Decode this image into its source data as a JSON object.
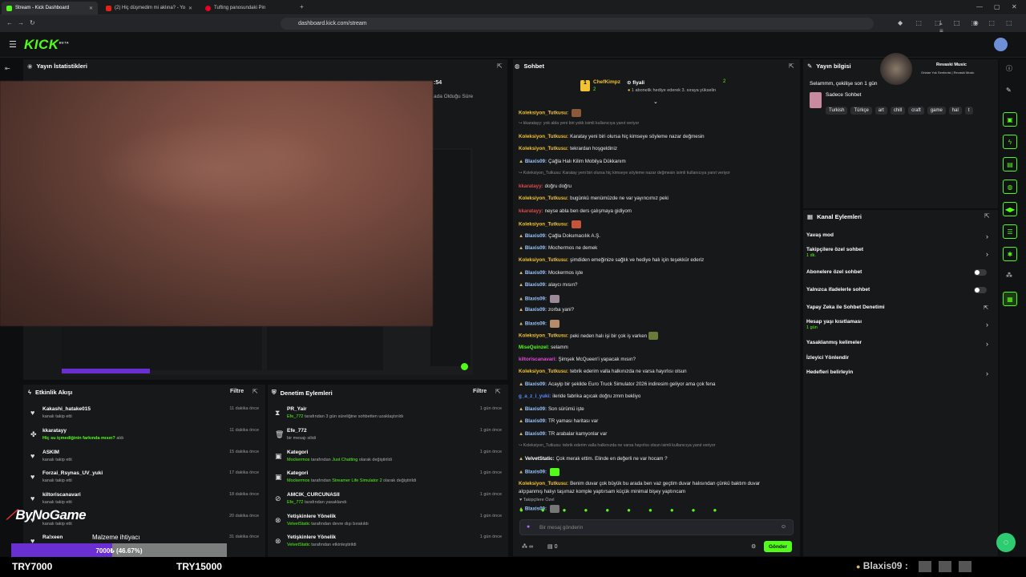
{
  "browser": {
    "tabs": [
      {
        "label": "Stream - Kick Dashboard"
      },
      {
        "label": "(2) Hiç düşmedim mi aklına? - Yo"
      },
      {
        "label": "Tufting panosundaki Pin"
      }
    ],
    "url": "dashboard.kick.com/stream"
  },
  "kick": {
    "logo": "KICK",
    "beta": "BETA"
  },
  "stats": {
    "title": "Yayın İstatistikleri",
    "clock": ":54",
    "subtitle": "ada Olduğu Süre"
  },
  "activity": {
    "title": "Etkinlik Akışı",
    "filter": "Filtre",
    "items": [
      {
        "name": "Kakashi_hatake015",
        "detail": "kanalı takip etti",
        "time": "11 dakika önce"
      },
      {
        "name": "kkaratayy",
        "detail": "Hiç su içmediğinin farkında mısın?",
        "detail2": "aldı",
        "time": "11 dakika önce"
      },
      {
        "name": "ASKIM",
        "detail": "kanalı takip etti",
        "time": "15 dakika önce"
      },
      {
        "name": "Forzai_Rsynas_UV_yuki",
        "detail": "kanalı takip etti",
        "time": "17 dakika önce"
      },
      {
        "name": "kiltoriscanavari",
        "detail": "kanalı takip etti",
        "time": "18 dakika önce"
      },
      {
        "name": "",
        "detail": "kanalı takip etti",
        "time": "20 dakika önce"
      },
      {
        "name": "Ra!xeen",
        "detail": "",
        "time": "31 dakika önce"
      }
    ]
  },
  "modlog": {
    "title": "Denetim Eylemleri",
    "filter": "Filtre",
    "items": [
      {
        "name": "PR_Yair",
        "actor": "Efe_772",
        "detail": "tarafından 3 gün süreliğine sohbetten uzaklaştırıldı",
        "time": "1 gün önce"
      },
      {
        "name": "Efe_772",
        "actor": "",
        "detail": "bir mesajı silidi",
        "time": "1 gün önce"
      },
      {
        "name": "Kategori",
        "actor": "Mockermos",
        "detail": "tarafından",
        "detail_green": "Just Chatting",
        "detail_tail": "olarak değiştirildi",
        "time": "1 gün önce"
      },
      {
        "name": "Kategori",
        "actor": "Mockermos",
        "detail": "tarafından",
        "detail_green": "Streamer Life Simulator 2",
        "detail_tail": "olarak değiştirildi",
        "time": "1 gün önce"
      },
      {
        "name": "AMCIK_CURCUNASII",
        "actor": "Efe_772",
        "detail": "tarafından yasaklandı",
        "time": "1 gün önce"
      },
      {
        "name": "Yetişkinlere Yönelik",
        "actor": "VelvetStatic",
        "detail": "tarafından devre dışı bırakıldı",
        "time": "1 gün önce"
      },
      {
        "name": "Yetişkinlere Yönelik",
        "actor": "VelvetStatic",
        "detail": "tarafından etkinleştirildi",
        "time": "1 gün önce"
      }
    ]
  },
  "overlay": {
    "brand": "ByNoGame",
    "goal_title": "Malzeme ihtiyacı",
    "goal_value": "7000₺ (46.67%)",
    "goal_progress": 0.4667,
    "goal_min": "TRY7000",
    "goal_max": "TRY15000",
    "bottom_user": "Blaxis09 :"
  },
  "chat": {
    "title": "Sohbet",
    "leader": {
      "name": "ChefKimpz",
      "count_left": "2",
      "user": "fiyali",
      "count_right": "2",
      "note": "1 abonelik hediye ederek 3. sıraya yükselin"
    },
    "messages": [
      {
        "user": "Koleksiyon_Tutkusu:",
        "text": "",
        "color": "#f1c232",
        "emote": "#8a5a3a"
      },
      {
        "reply": "↪ kkaratayy: yok abla yeni biri yokk isimli kullanıcıya yanıt veriyor"
      },
      {
        "user": "Koleksiyon_Tutkusu:",
        "text": "Karatay yeni biri olursa hiç kimseye söyleme nazar değmesin",
        "color": "#f1c232"
      },
      {
        "user": "Koleksiyon_Tutkusu:",
        "text": "tekrardan hoşgeldiniz",
        "color": "#f1c232"
      },
      {
        "user": "Blaxis09:",
        "text": "Çağla Halı Kilim Mobilya Dükkanım",
        "color": "#9cc5ff",
        "badge": true
      },
      {
        "reply": "↪ Koleksiyon_Tutkusu: Karatay yeni biri olursa hiç kimseye söyleme nazar değmesin isimli kullanıcıya yanıt veriyor"
      },
      {
        "user": "kkaratayy:",
        "text": "doğru doğru",
        "color": "#d94a4a"
      },
      {
        "user": "Koleksiyon_Tutkusu:",
        "text": "bugünkü menümüzde ne var yayıncımız peki",
        "color": "#f1c232"
      },
      {
        "user": "kkaratayy:",
        "text": "neyse abla ben ders çalışmaya gidiyom",
        "color": "#d94a4a"
      },
      {
        "user": "Koleksiyon_Tutkusu:",
        "text": "",
        "color": "#f1c232",
        "emote": "#c4553a"
      },
      {
        "user": "Blaxis09:",
        "text": "Çağla Dokumacılık A.Ş.",
        "color": "#9cc5ff",
        "badge": true
      },
      {
        "user": "Blaxis09:",
        "text": "Mochermos ne demek",
        "color": "#9cc5ff",
        "badge": true
      },
      {
        "user": "Koleksiyon_Tutkusu:",
        "text": "şimdiden emeğinize sağlık ve hediye halı için teşekkür ederiz",
        "color": "#f1c232"
      },
      {
        "user": "Blaxis09:",
        "text": "Mockermos işte",
        "color": "#9cc5ff",
        "badge": true
      },
      {
        "user": "Blaxis09:",
        "text": "alaycı mısın?",
        "color": "#9cc5ff",
        "badge": true
      },
      {
        "user": "Blaxis09:",
        "text": "",
        "color": "#9cc5ff",
        "badge": true,
        "emote": "#9a8a9a"
      },
      {
        "user": "Blaxis09:",
        "text": "zorba yani?",
        "color": "#9cc5ff",
        "badge": true
      },
      {
        "user": "Blaxis09:",
        "text": "",
        "color": "#9cc5ff",
        "badge": true,
        "emote": "#b68a6a"
      },
      {
        "user": "Koleksiyon_Tutkusu:",
        "text": "peki neden halı işi bir çok iş varken",
        "color": "#f1c232",
        "emote": "#6a7a3a"
      },
      {
        "user": "MiseQuinzel:",
        "text": "selamm",
        "color": "#53fc18"
      },
      {
        "user": "kiltoriscanavari:",
        "text": "Şimşek McQueen'i yapacak mısın?",
        "color": "#e24ad6"
      },
      {
        "user": "Koleksiyon_Tutkusu:",
        "text": "tebrik ederim valla halkınızda ne varsa hayırlısı olsun",
        "color": "#f1c232"
      },
      {
        "user": "Blaxis09:",
        "text": "Acayip bir şekilde Euro Truck Simulator 2026 indiresim geliyor ama çok fena",
        "color": "#9cc5ff",
        "badge": true
      },
      {
        "user": "g_a_z_i_yuki:",
        "text": "ileride fabrika açıcak doğru zmm bekliyo",
        "color": "#5b8cff"
      },
      {
        "user": "Blaxis09:",
        "text": "Son sürümü işte",
        "color": "#9cc5ff",
        "badge": true
      },
      {
        "user": "Blaxis09:",
        "text": "TR yaması haritası var",
        "color": "#9cc5ff",
        "badge": true
      },
      {
        "user": "Blaxis09:",
        "text": "TR arabalar kamyonlar var",
        "color": "#9cc5ff",
        "badge": true
      },
      {
        "reply": "↪ Koleksiyon_Tutkusu: tebrik ederim valla halkınızda ne varsa hayırlısı olsun isimli kullanıcıya yanıt veriyor"
      },
      {
        "user": "VelvetStatic:",
        "text": "Çok merak ettim. Elinde en değerli ne var hocam ?",
        "color": "#ffffff",
        "badge": true
      },
      {
        "user": "Blaxis09:",
        "text": "",
        "color": "#9cc5ff",
        "badge": true,
        "emote": "#53fc18"
      },
      {
        "user": "Koleksiyon_Tutkusu:",
        "text": "Benim duvar çok büyük bu arada ben vaz geçtim duvar halısından çünkü baktım duvar",
        "color": "#f1c232"
      },
      {
        "cont": "alçıpanmış halıyı taşımaz komple yaptırsam küçük minimal bişey yaptırıcam"
      },
      {
        "user": "Blaxis09:",
        "text": "",
        "color": "#9cc5ff",
        "badge": true,
        "emote": "#777777"
      }
    ],
    "followers_only": "Takipçilere Özel",
    "input_placeholder": "Bir mesaj gönderin",
    "stat_left": "∞",
    "stat_right": "0",
    "send": "Gönder"
  },
  "info": {
    "title": "Yayın bilgisi",
    "stream_title": "Selammm, çekilişe son 1 gün",
    "music_title": "Revaski Music",
    "music_sub": "Ortalar Yok Senfonisi | Revaski Music",
    "category": "Sadece Sohbet",
    "tags": [
      "Turkish",
      "Türkçe",
      "art",
      "chill",
      "craft",
      "game",
      "hal",
      "t"
    ]
  },
  "channel_actions": {
    "title": "Kanal Eylemleri",
    "items": [
      {
        "label": "Yavaş mod",
        "type": "chev"
      },
      {
        "label": "Takipçilere özel sohbet",
        "sub": "1 dk.",
        "type": "chev"
      },
      {
        "label": "Abonelere özel sohbet",
        "type": "toggle"
      },
      {
        "label": "Yalnızca ifadelerle sohbet",
        "type": "toggle"
      },
      {
        "label": "Yapay Zeka ile Sohbet Denetimi",
        "type": "ext"
      },
      {
        "label": "Hesap yaşı kısıtlaması",
        "sub": "1 gün",
        "type": "chev"
      },
      {
        "label": "Yasaklanmış kelimeler",
        "type": "chev"
      },
      {
        "label": "İzleyici Yönlendir",
        "type": "none"
      },
      {
        "label": "Hedefleri belirleyin",
        "type": "chev"
      }
    ]
  }
}
